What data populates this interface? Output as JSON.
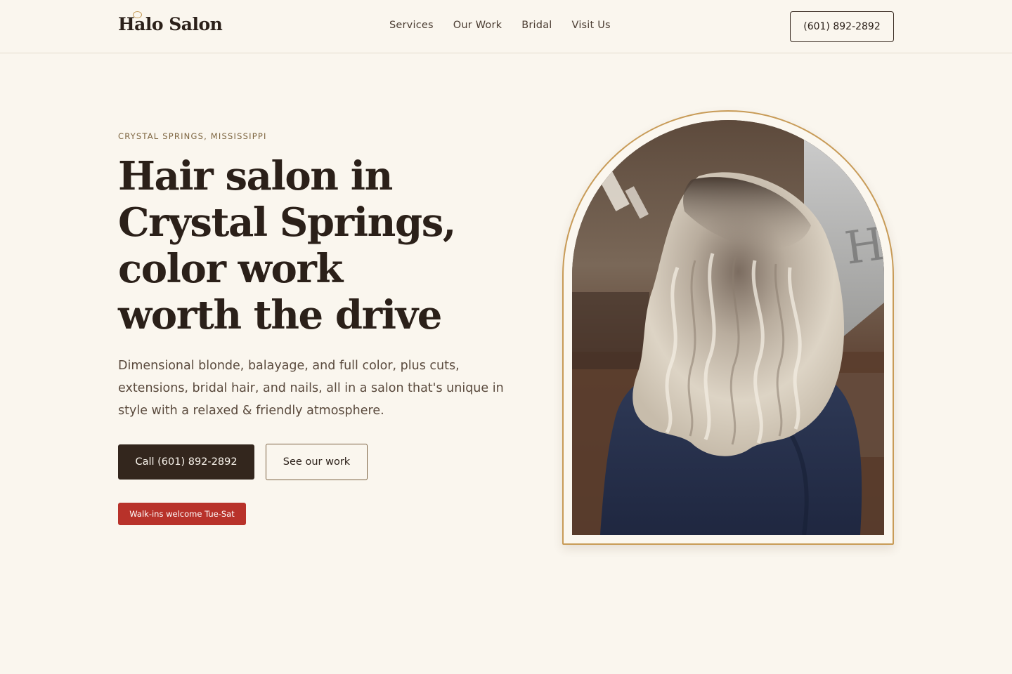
{
  "header": {
    "logo": "Halo Salon",
    "nav": [
      "Services",
      "Our Work",
      "Bridal",
      "Visit Us"
    ],
    "phone": "(601) 892-2892"
  },
  "hero": {
    "eyebrow": "CRYSTAL SPRINGS, MISSISSIPPI",
    "headline_lines": [
      "Hair salon in",
      "Crystal Springs,",
      "color work",
      "worth the drive"
    ],
    "lede": "Dimensional blonde, balayage, and full color, plus cuts, extensions, bridal hair, and nails, all in a salon that's unique in style with a relaxed & friendly atmosphere.",
    "cta_primary": "Call (601) 892-2892",
    "cta_secondary": "See our work",
    "walkin_badge": "Walk-ins welcome Tue-Sat",
    "photo_sign_text": "HALO"
  },
  "colors": {
    "background": "#faf6ee",
    "text": "#2b2019",
    "accent_gold": "#c89b57",
    "button_dark": "#33261d",
    "badge_red": "#b8322a"
  }
}
